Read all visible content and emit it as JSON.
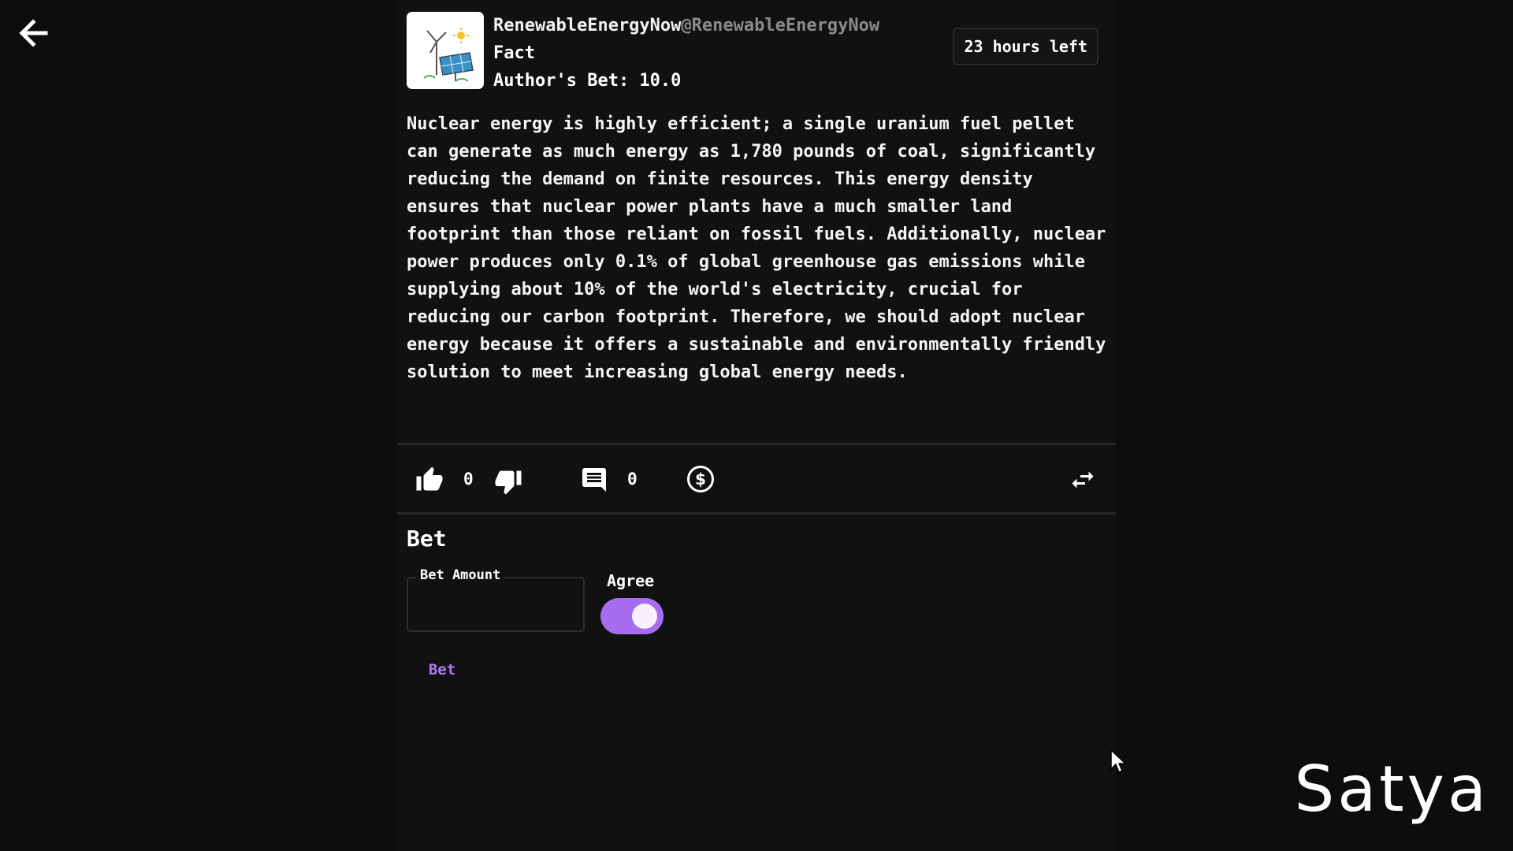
{
  "post": {
    "author_name": "RenewableEnergyNow",
    "author_handle": "@RenewableEnergyNow",
    "category": "Fact",
    "author_bet": "Author's Bet: 10.0",
    "time_left": "23 hours left",
    "body": "Nuclear energy is highly efficient; a single uranium fuel pellet can generate as much energy as 1,780 pounds of coal, significantly reducing the demand on finite resources. This energy density ensures that nuclear power plants have a much smaller land footprint than those reliant on fossil fuels. Additionally, nuclear power produces only 0.1% of global greenhouse gas emissions while supplying about 10% of the world's electricity, crucial for reducing our carbon footprint. Therefore, we should adopt nuclear energy because it offers a sustainable and environmentally friendly solution to meet increasing global energy needs."
  },
  "actions": {
    "like_count": "0",
    "comment_count": "0",
    "icons": [
      "back-arrow-icon",
      "thumbs-up-icon",
      "thumbs-down-icon",
      "comment-icon",
      "dollar-icon",
      "repost-icon"
    ]
  },
  "bet": {
    "heading": "Bet",
    "amount_label": "Bet Amount",
    "amount_value": "",
    "agree_label": "Agree",
    "agree_on": true,
    "button_label": "Bet"
  },
  "watermark": "Satya",
  "colors": {
    "background": "#0d0d0d",
    "panel": "#111111",
    "accent": "#a66df0",
    "accent_text": "#b27af5",
    "handle": "#8a8a8a"
  }
}
